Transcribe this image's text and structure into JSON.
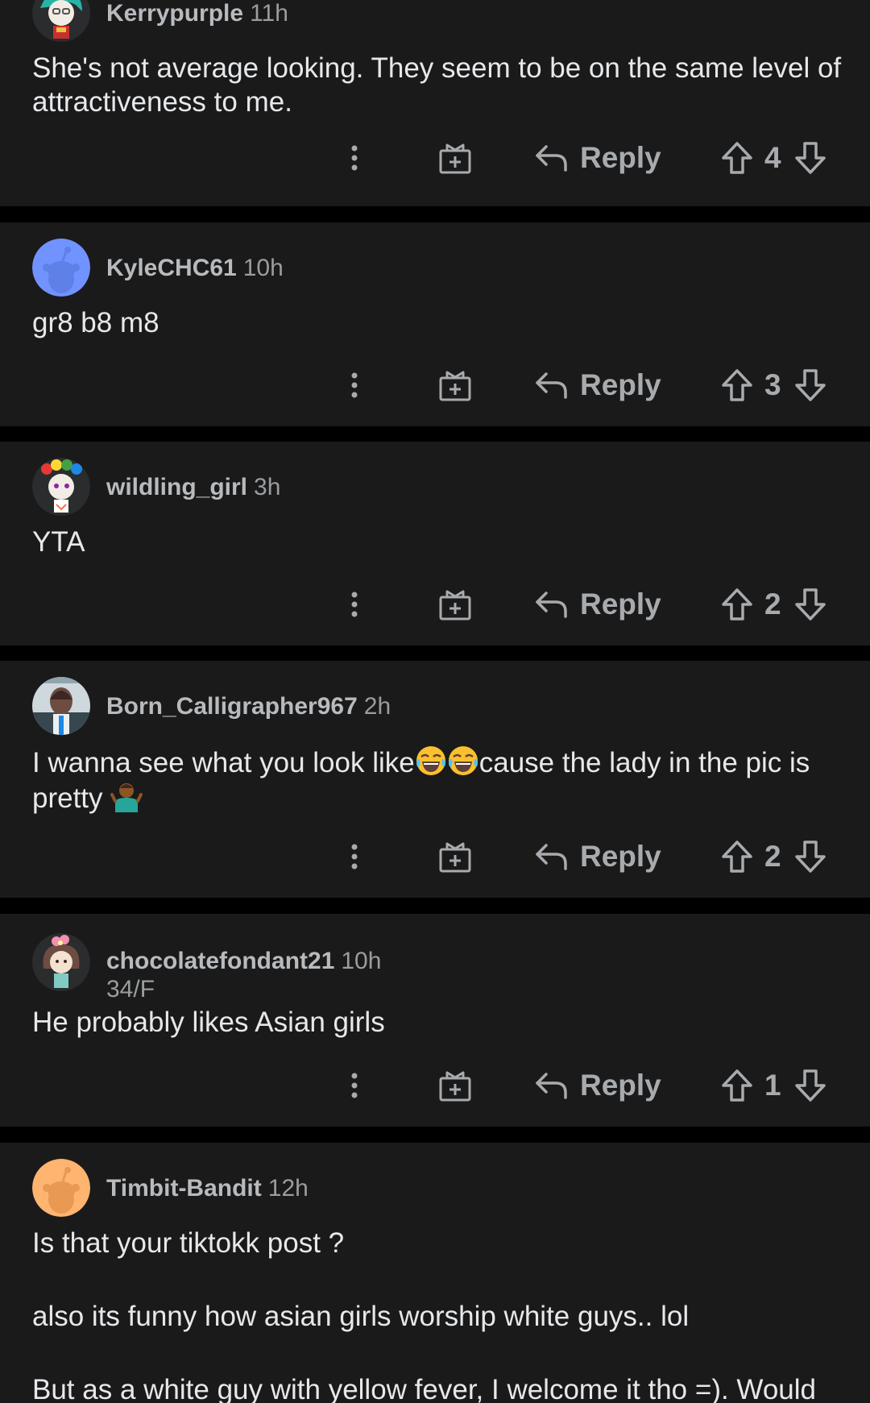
{
  "labels": {
    "reply": "Reply"
  },
  "comments": [
    {
      "username": "Kerrypurple",
      "time": "11h",
      "avatar": "snoo-avatar-teal-hair",
      "body": [
        "She's not average looking. They seem to be on the same level of attractiveness to me."
      ],
      "score": "4"
    },
    {
      "username": "KyleCHC61",
      "time": "10h",
      "avatar": "default-snoo-blue",
      "body": [
        "gr8 b8 m8"
      ],
      "score": "3"
    },
    {
      "username": "wildling_girl",
      "time": "3h",
      "avatar": "snoo-avatar-rainbow-hair",
      "body": [
        "YTA"
      ],
      "score": "2"
    },
    {
      "username": "Born_Calligrapher967",
      "time": "2h",
      "avatar": "user-photo",
      "body_parts": {
        "before": "I wanna see what you look like",
        "after": "cause the lady in the pic is pretty"
      },
      "emojis": [
        "face-with-tears-of-joy-emoji",
        "face-with-tears-of-joy-emoji",
        "person-shrugging-emoji"
      ],
      "score": "2"
    },
    {
      "username": "chocolatefondant21",
      "time": "10h",
      "flair": "34/F",
      "avatar": "snoo-avatar-flower-hair",
      "body": [
        "He probably likes Asian girls"
      ],
      "score": "1"
    },
    {
      "username": "Timbit-Bandit",
      "time": "12h",
      "avatar": "default-snoo-orange",
      "body": [
        "Is that your tiktokk post ?",
        "also its funny how asian girls worship white guys.. lol",
        "But as a white guy with yellow fever, I welcome it tho =). Would"
      ]
    }
  ],
  "colors": {
    "page_bg": "#000000",
    "card_bg": "#1a1a1b",
    "text": "#e6e8ea",
    "meta": "#9a9d9f",
    "icon": "#a8abae"
  }
}
